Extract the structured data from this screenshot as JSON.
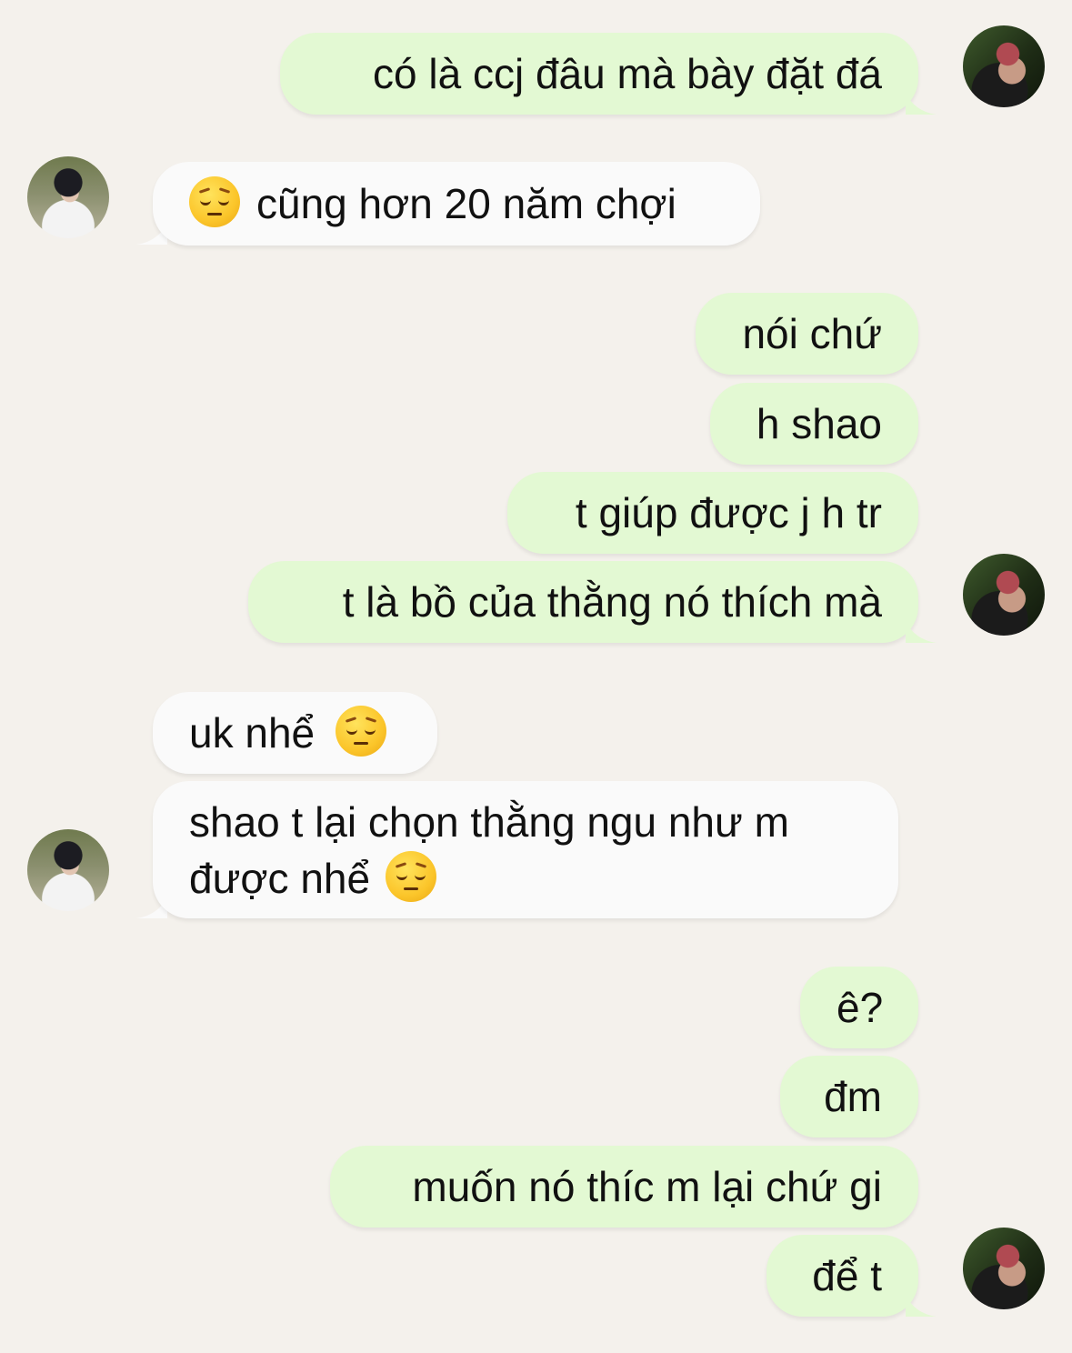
{
  "messages": {
    "m1": {
      "sender": "me",
      "text": "có là ccj đâu mà bày đặt đá"
    },
    "m2": {
      "sender": "them",
      "emoji": "pensive-face-emoji",
      "text": "cũng hơn 20 năm chợi"
    },
    "m3": {
      "sender": "me",
      "text": "nói chứ"
    },
    "m4": {
      "sender": "me",
      "text": "h shao"
    },
    "m5": {
      "sender": "me",
      "text": "t giúp được j h tr"
    },
    "m6": {
      "sender": "me",
      "text": "t là bồ của thằng nó thích mà"
    },
    "m7": {
      "sender": "them",
      "text": "uk nhể",
      "emoji": "pensive-face-emoji"
    },
    "m8": {
      "sender": "them",
      "text_line1": "shao t lại chọn thằng ngu như m",
      "text_line2": "được nhể",
      "emoji": "pensive-face-emoji"
    },
    "m9": {
      "sender": "me",
      "text": "ê?"
    },
    "m10": {
      "sender": "me",
      "text": "đm"
    },
    "m11": {
      "sender": "me",
      "text": "muốn nó thíc m lại chứ gi"
    },
    "m12": {
      "sender": "me",
      "text": "để t"
    }
  },
  "colors": {
    "background": "#f4f1ec",
    "outgoing_bubble": "#e3f9d3",
    "incoming_bubble": "#fafafa",
    "text": "#111111"
  }
}
